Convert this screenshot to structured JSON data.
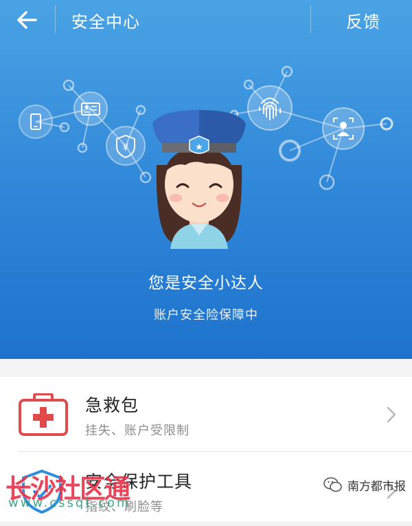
{
  "header": {
    "title": "安全中心",
    "feedback_label": "反馈",
    "back_icon": "arrow-left-icon"
  },
  "hero": {
    "title": "您是安全小达人",
    "subtitle": "账户安全险保障中",
    "colors": {
      "top": "#4aa3e4",
      "bottom": "#1e72cc"
    },
    "icons": [
      "phone-icon",
      "id-card-icon",
      "yuan-shield-icon",
      "fingerprint-icon",
      "face-scan-icon",
      "police-avatar-icon"
    ],
    "badge_symbol": "★",
    "yuan_symbol": "¥"
  },
  "list": {
    "items": [
      {
        "title": "急救包",
        "subtitle": "挂失、账户受限制",
        "icon": "first-aid-kit-icon"
      },
      {
        "title": "安全保护工具",
        "subtitle": "指纹、刷脸等",
        "icon": "shield-tools-icon"
      }
    ]
  },
  "watermark": {
    "site_name": "长沙社区通",
    "site_url": "www.cssqt.com",
    "source": "南方都市报"
  }
}
